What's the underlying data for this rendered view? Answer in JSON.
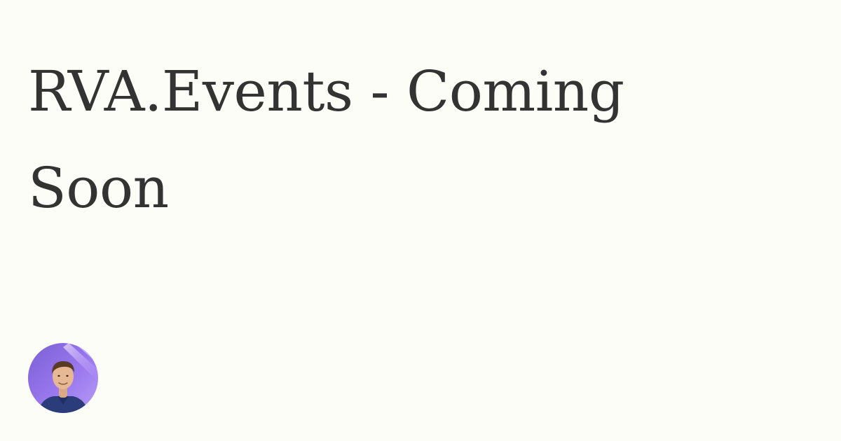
{
  "card": {
    "title": "RVA.Events - Coming Soon",
    "background_color": "#fdfdf8",
    "text_color": "#333333"
  },
  "author": {
    "avatar_icon": "author-avatar-photo"
  }
}
